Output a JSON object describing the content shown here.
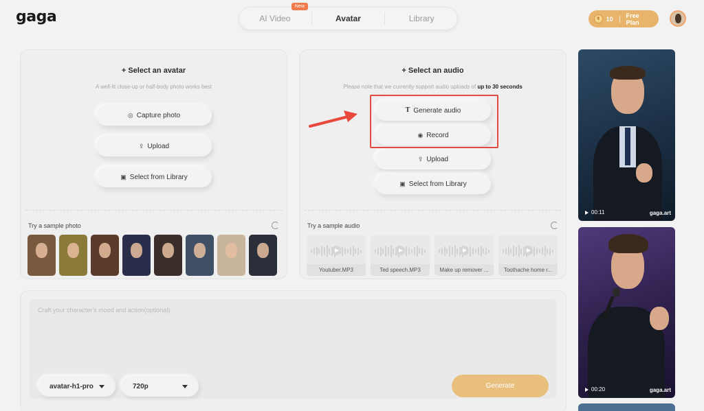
{
  "header": {
    "logo": "gaga",
    "tabs": [
      {
        "label": "AI Video",
        "badge": "New"
      },
      {
        "label": "Avatar"
      },
      {
        "label": "Library"
      }
    ],
    "credits": "10",
    "plan": "Free Plan"
  },
  "avatar_panel": {
    "title": "+ Select an avatar",
    "subtitle": "A well-lit close-up or half-body photo works best",
    "buttons": {
      "capture": "Capture photo",
      "upload": "Upload",
      "library": "Select from Library"
    },
    "sample_label": "Try a sample photo",
    "thumb_colors": [
      "#7a5a3e",
      "#8a7a3a",
      "#5a3a2a",
      "#2a2e4a",
      "#3a2e2a",
      "#3e4f66",
      "#c9b59b",
      "#2b2f3a"
    ]
  },
  "audio_panel": {
    "title": "+ Select an audio",
    "subtitle_prefix": "Please note that we currently support audio uploads of ",
    "subtitle_bold": "up to 30 seconds",
    "buttons": {
      "generate": "Generate audio",
      "record": "Record",
      "upload": "Upload",
      "library": "Select from Library"
    },
    "sample_label": "Try a sample audio",
    "samples": [
      "Youtuber.MP3",
      "Ted speech.MP3",
      "Make up remover ...",
      "Toothache home r..."
    ]
  },
  "prompt": {
    "placeholder": "Craft your character's mood and action(optional)",
    "model": "avatar-h1-pro",
    "resolution": "720p",
    "generate_label": "Generate"
  },
  "gallery": {
    "cards": [
      {
        "duration": "00:11",
        "watermark": "gaga.art"
      },
      {
        "duration": "00:20",
        "watermark": "gaga.art"
      }
    ]
  },
  "colors": {
    "accent": "#e8b46c",
    "highlight": "#e24a40",
    "badge": "#f07a4b"
  }
}
